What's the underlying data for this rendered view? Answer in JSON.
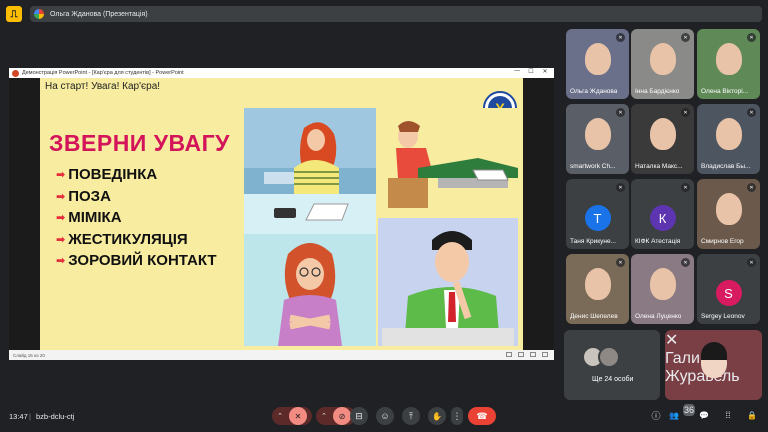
{
  "top": {
    "presenter_label": "Ольга Жданова (Презентація)"
  },
  "ppt": {
    "window_title": "Демонстрація PowerPoint - [Кар'єра для студентів] - PowerPoint",
    "status": "Слайд 16 из 20",
    "win_min": "—",
    "win_max": "☐",
    "win_close": "✕"
  },
  "slide": {
    "top_title": "На старт! Увага! Кар'єра!",
    "heading": "ЗВЕРНИ УВАГУ",
    "items": [
      "ПОВЕДІНКА",
      "ПОЗА",
      "МІМІКА",
      "ЖЕСТИКУЛЯЦІЯ",
      "ЗОРОВИЙ КОНТАКТ"
    ],
    "bullet_glyph": "➡"
  },
  "participants": [
    {
      "name": "Ольга Жданова",
      "initial": "",
      "color": "#6a6f8a"
    },
    {
      "name": "Інна Бардієнко",
      "initial": "",
      "color": "#8a8a88"
    },
    {
      "name": "Олена Вікторі...",
      "initial": "",
      "color": "#5f8a58"
    },
    {
      "name": "smartwork Ch...",
      "initial": "",
      "color": "#5a5e66"
    },
    {
      "name": "Наталка Макс...",
      "initial": "",
      "color": "#3a3a3a"
    },
    {
      "name": "Владислав Бы...",
      "initial": "",
      "color": "#4c5560"
    },
    {
      "name": "Таня Крикуне...",
      "initial": "Т",
      "color": "#1a73e8"
    },
    {
      "name": "КІФК Атестація",
      "initial": "К",
      "color": "#5e35b1"
    },
    {
      "name": "Смирнов Егор",
      "initial": "",
      "color": "#6b5a4c"
    },
    {
      "name": "Денис Шепелев",
      "initial": "",
      "color": "#7a6a58"
    },
    {
      "name": "Олена Луценко",
      "initial": "",
      "color": "#8a7a84"
    },
    {
      "name": "Sergey Leonov",
      "initial": "S",
      "color": "#d81b60"
    }
  ],
  "more": {
    "label": "Ще 24 особи"
  },
  "pinned": {
    "name": "Галина Журавель"
  },
  "bottom": {
    "time": "13:47",
    "separator": "|",
    "meeting_code": "bzb-dclu-ctj",
    "people_count": "36"
  },
  "icons": {
    "mic": "🎤",
    "cam": "📷",
    "captions": "⊟",
    "emoji": "☺",
    "present": "⤒",
    "hand": "✋",
    "more": "⋮",
    "hangup": "☎",
    "chevron": "⌃",
    "info": "ⓘ",
    "people": "👥",
    "chat": "💬",
    "apps": "⁞⁞",
    "lock": "🔒"
  }
}
